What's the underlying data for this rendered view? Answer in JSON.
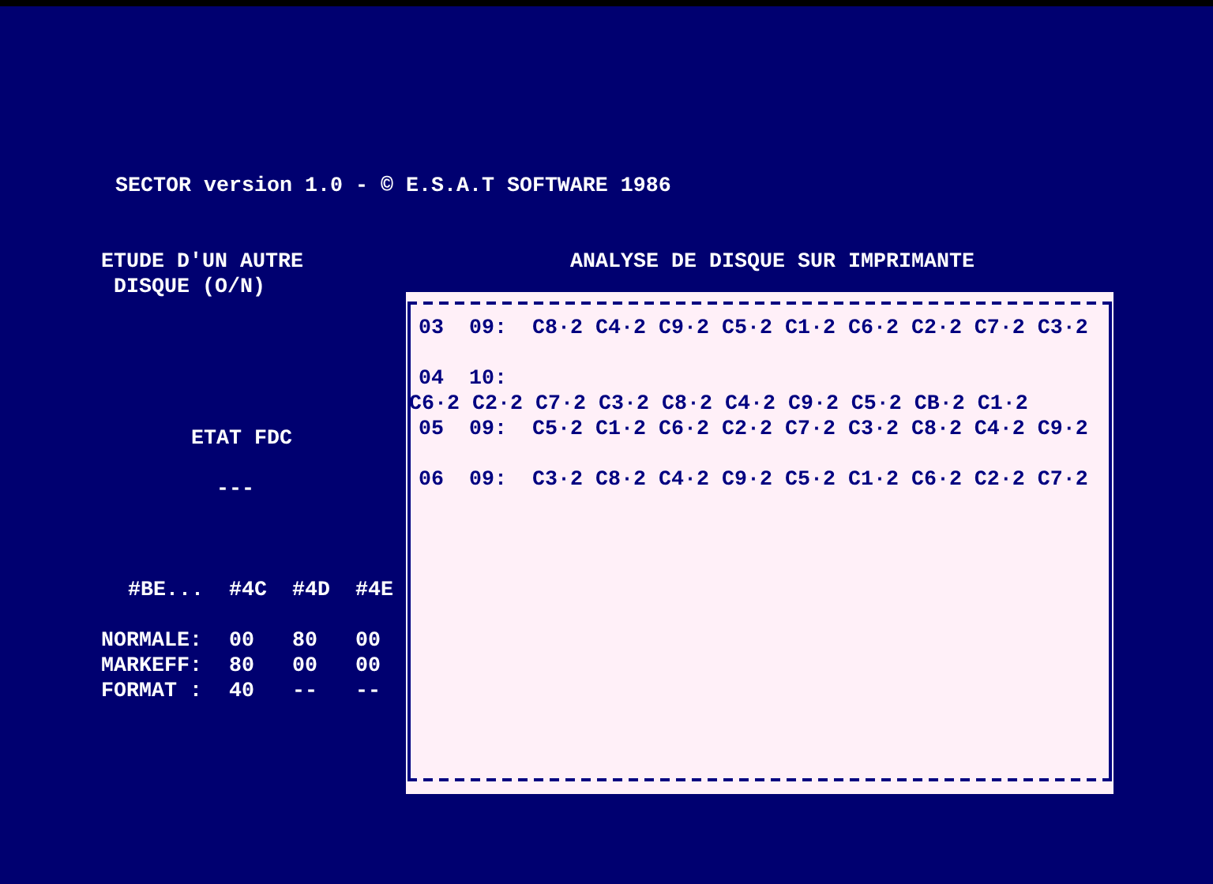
{
  "title": "SECTOR version 1.0 - © E.S.A.T SOFTWARE 1986",
  "prompt": [
    "ETUDE D'UN AUTRE",
    "DISQUE (O/N)"
  ],
  "fdc_status": {
    "title": "ETAT FDC",
    "value": "---",
    "columns": [
      "#BE...",
      "#4C",
      "#4D",
      "#4E"
    ],
    "rows": [
      {
        "label": "NORMALE:",
        "values": [
          "00",
          "80",
          "00"
        ]
      },
      {
        "label": "MARKEFF:",
        "values": [
          "80",
          "00",
          "00"
        ]
      },
      {
        "label": "FORMAT :",
        "values": [
          "40",
          "--",
          "--"
        ]
      }
    ]
  },
  "printer_panel": {
    "header": "ANALYSE DE DISQUE SUR IMPRIMANTE",
    "lines": [
      {
        "kind": "track",
        "track": "03",
        "count": "09:",
        "sectors": "C8·2 C4·2 C9·2 C5·2 C1·2 C6·2 C2·2 C7·2 C3·2"
      },
      {
        "kind": "blank"
      },
      {
        "kind": "track",
        "track": "04",
        "count": "10:"
      },
      {
        "kind": "continuation",
        "sectors": "C6·2 C2·2 C7·2 C3·2 C8·2 C4·2 C9·2 C5·2 CB·2 C1·2"
      },
      {
        "kind": "track",
        "track": "05",
        "count": "09:",
        "sectors": "C5·2 C1·2 C6·2 C2·2 C7·2 C3·2 C8·2 C4·2 C9·2"
      },
      {
        "kind": "blank"
      },
      {
        "kind": "track",
        "track": "06",
        "count": "09:",
        "sectors": "C3·2 C8·2 C4·2 C9·2 C5·2 C1·2 C6·2 C2·2 C7·2"
      }
    ]
  }
}
